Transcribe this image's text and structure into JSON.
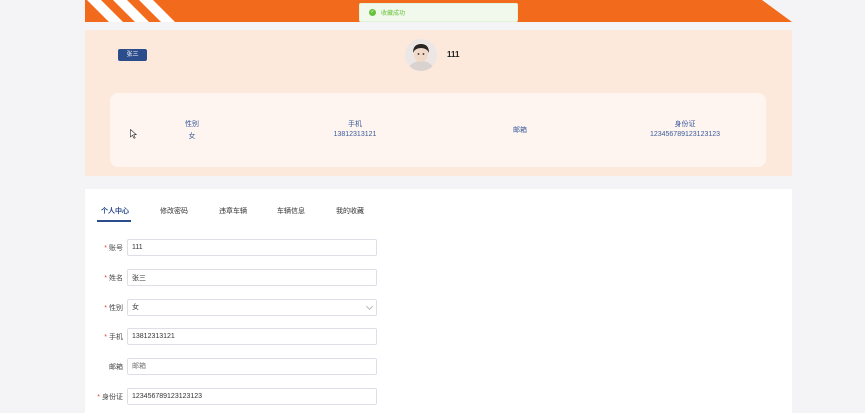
{
  "toast": {
    "message": "收藏成功"
  },
  "profile": {
    "name_tag": "张三",
    "username": "111",
    "info": [
      {
        "label": "性别",
        "value": "女"
      },
      {
        "label": "手机",
        "value": "13812313121"
      },
      {
        "label": "邮箱",
        "value": ""
      },
      {
        "label": "身份证",
        "value": "123456789123123123"
      }
    ]
  },
  "tabs": [
    "个人中心",
    "修改密码",
    "违章车辆",
    "车辆信息",
    "我的收藏"
  ],
  "form": {
    "account": {
      "label": "账号",
      "value": "111"
    },
    "name": {
      "label": "姓名",
      "value": "张三"
    },
    "gender": {
      "label": "性别",
      "value": "女"
    },
    "phone": {
      "label": "手机",
      "value": "13812313121"
    },
    "email": {
      "label": "邮箱",
      "placeholder": "邮箱"
    },
    "id_card": {
      "label": "身份证",
      "value": "123456789123123123"
    }
  },
  "colors": {
    "accent": "#2b4d8c",
    "banner": "#f26a1b",
    "card": "#fde8dc",
    "success": "#67c23a"
  }
}
